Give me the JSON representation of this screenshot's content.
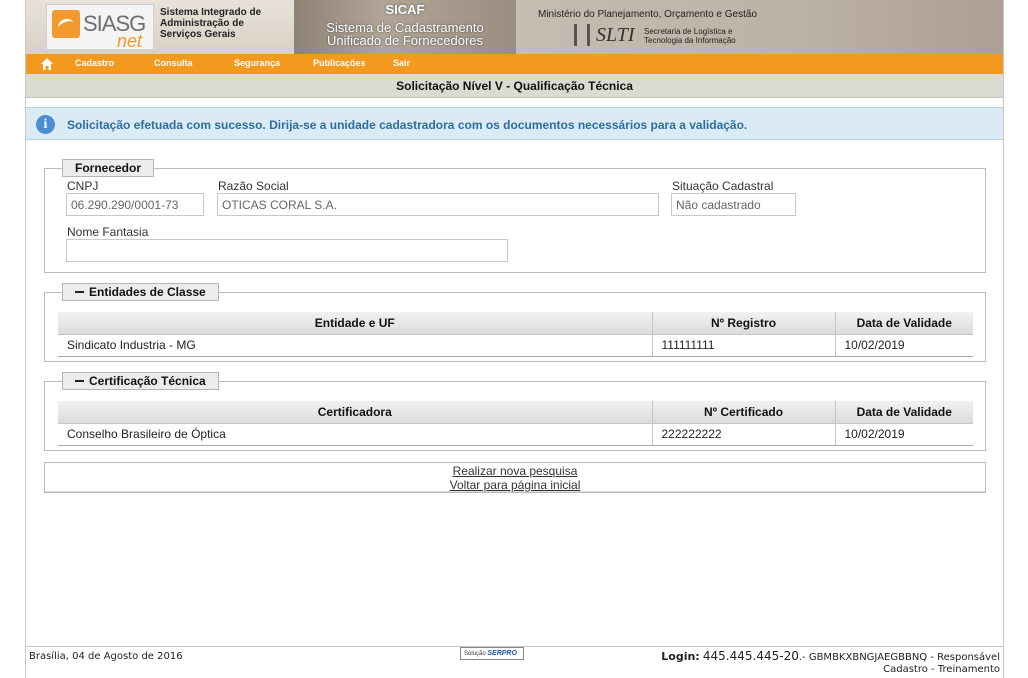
{
  "header": {
    "logo_text": "SIASG",
    "logo_suffix": "net",
    "siasg_desc": [
      "Sistema Integrado de",
      "Administração de",
      "Serviços Gerais"
    ],
    "sicaf_title": "SICAF",
    "sicaf_sub1": "Sistema de Cadastramento",
    "sicaf_sub2": "Unificado de Fornecedores",
    "ministry": "Ministério do Planejamento, Orçamento e Gestão",
    "slti": "SLTI",
    "slti_desc": [
      "Secretaria de Logística e",
      "Tecnologia da Informação"
    ]
  },
  "menu": {
    "items": [
      "Cadastro",
      "Consulta",
      "Segurança",
      "Publicações",
      "Sair"
    ]
  },
  "page_title": "Solicitação Nível V - Qualificação Técnica",
  "info_message": "Solicitação efetuada com sucesso. Dirija-se a unidade cadastradora com os documentos necessários para a validação.",
  "fornecedor": {
    "legend": "Fornecedor",
    "cnpj_label": "CNPJ",
    "cnpj_value": "06.290.290/0001-73",
    "razao_label": "Razão Social",
    "razao_value": "OTICAS CORAL S.A.",
    "situacao_label": "Situação Cadastral",
    "situacao_value": "Não cadastrado",
    "fantasia_label": "Nome Fantasia",
    "fantasia_value": ""
  },
  "entidades": {
    "legend": "Entidades de Classe",
    "headers": [
      "Entidade e UF",
      "Nº Registro",
      "Data de Validade"
    ],
    "rows": [
      [
        "Sindicato Industria - MG",
        "111111111",
        "10/02/2019"
      ]
    ]
  },
  "certificacao": {
    "legend": "Certificação Técnica",
    "headers": [
      "Certificadora",
      "Nº Certificado",
      "Data de Validade"
    ],
    "rows": [
      [
        "Conselho Brasileiro de Óptica",
        "222222222",
        "10/02/2019"
      ]
    ]
  },
  "links": {
    "nova_pesquisa": "Realizar nova pesquisa",
    "pagina_inicial": "Voltar para página inicial"
  },
  "footer": {
    "date": "Brasília, 04 de Agosto de 2016",
    "serpro_prefix": "Solução",
    "serpro_brand": "SERPRO",
    "login_label": "Login:",
    "login_value": "445.445.445-20",
    "login_rest": ".- GBMBKXBNGJAEGBBNQ - Responsável",
    "login_line2": "Cadastro - Treinamento"
  }
}
